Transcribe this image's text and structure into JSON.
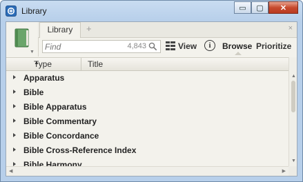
{
  "window": {
    "title": "Library"
  },
  "window_controls": {
    "minimize": "▭",
    "maximize": "▢",
    "close": "✕"
  },
  "tabs": {
    "active_label": "Library",
    "add_symbol": "+",
    "close_symbol": "×"
  },
  "toolbar": {
    "find_placeholder": "Find",
    "result_count": "4,843",
    "view_label": "View",
    "info_symbol": "i",
    "browse_label": "Browse",
    "prioritize_label": "Prioritize"
  },
  "list": {
    "columns": {
      "type": "Type",
      "title": "Title"
    },
    "sort_indicator": "▲",
    "rows": [
      "Apparatus",
      "Bible",
      "Bible Apparatus",
      "Bible Commentary",
      "Bible Concordance",
      "Bible Cross-Reference Index",
      "Bible Harmony"
    ]
  }
}
